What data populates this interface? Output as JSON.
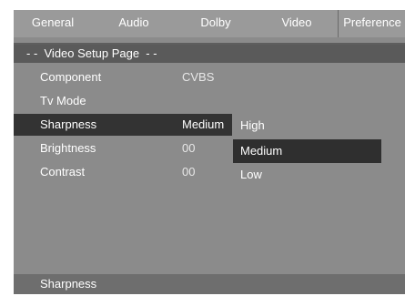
{
  "tabs": [
    "General",
    "Audio",
    "Dolby",
    "Video",
    "Preference"
  ],
  "page_header": "- -  Video Setup Page  - -",
  "settings": [
    {
      "label": "Component",
      "value": "CVBS"
    },
    {
      "label": "Tv Mode",
      "value": ""
    },
    {
      "label": "Sharpness",
      "value": "Medium"
    },
    {
      "label": "Brightness",
      "value": "00"
    },
    {
      "label": "Contrast",
      "value": "00"
    }
  ],
  "options": [
    "High",
    "Medium",
    "Low"
  ],
  "selected_option": "Medium",
  "status_text": "Sharpness"
}
